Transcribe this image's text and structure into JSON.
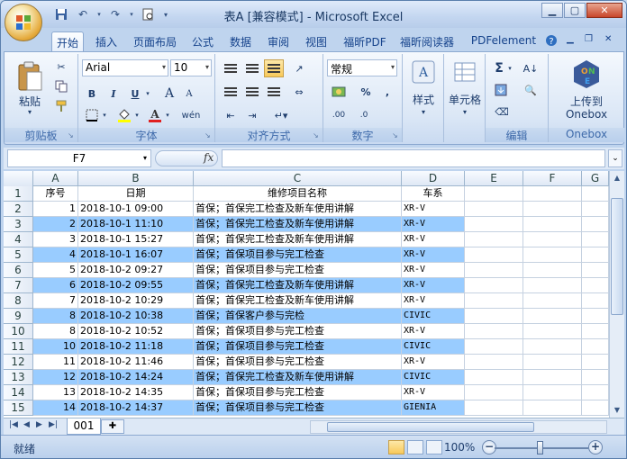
{
  "window": {
    "title": "表A  [兼容模式] - Microsoft Excel",
    "minimize_icon": "minimize-icon",
    "maximize_icon": "maximize-icon",
    "close_icon": "close-icon"
  },
  "ribbon_tabs": [
    {
      "label": "开始",
      "active": true
    },
    {
      "label": "插入"
    },
    {
      "label": "页面布局"
    },
    {
      "label": "公式"
    },
    {
      "label": "数据"
    },
    {
      "label": "审阅"
    },
    {
      "label": "视图"
    },
    {
      "label": "福昕PDF"
    },
    {
      "label": "福昕阅读器"
    },
    {
      "label": "PDFelement"
    }
  ],
  "ribbon": {
    "clipboard": {
      "label": "剪贴板",
      "paste": "粘贴"
    },
    "font": {
      "label": "字体",
      "font_name": "Arial",
      "font_size": "10",
      "bold": "B",
      "italic": "I",
      "underline": "U",
      "grow": "A",
      "shrink": "A",
      "phonetic": "wén"
    },
    "alignment": {
      "label": "对齐方式"
    },
    "number": {
      "label": "数字",
      "format": "常规",
      "percent": "%",
      "comma": ","
    },
    "styles": {
      "label": "样式"
    },
    "cells": {
      "label": "单元格"
    },
    "editing": {
      "label": "编辑",
      "sum": "Σ"
    },
    "onebox": {
      "label": "Onebox",
      "upload": "上传到",
      "upload2": "Onebox"
    }
  },
  "formula_bar": {
    "name_box": "F7",
    "fx": "fx",
    "formula": ""
  },
  "sheet": {
    "columns": [
      "A",
      "B",
      "C",
      "D",
      "E",
      "F",
      "G"
    ],
    "header_row": {
      "num": "1",
      "a": "序号",
      "b": "日期",
      "c": "维修项目名称",
      "d": "车系"
    },
    "rows": [
      {
        "num": "2",
        "a": "1",
        "b": "2018-10-1  09:00",
        "c": "首保；首保完工检查及新车使用讲解",
        "d": "XR-V",
        "blue": false
      },
      {
        "num": "3",
        "a": "2",
        "b": "2018-10-1  11:10",
        "c": "首保；首保完工检查及新车使用讲解",
        "d": "XR-V",
        "blue": true
      },
      {
        "num": "4",
        "a": "3",
        "b": "2018-10-1  15:27",
        "c": "首保；首保完工检查及新车使用讲解",
        "d": "XR-V",
        "blue": false
      },
      {
        "num": "5",
        "a": "4",
        "b": "2018-10-1  16:07",
        "c": "首保；首保项目参与完工检查",
        "d": "XR-V",
        "blue": true
      },
      {
        "num": "6",
        "a": "5",
        "b": "2018-10-2  09:27",
        "c": "首保；首保项目参与完工检查",
        "d": "XR-V",
        "blue": false
      },
      {
        "num": "7",
        "a": "6",
        "b": "2018-10-2  09:55",
        "c": "首保；首保完工检查及新车使用讲解",
        "d": "XR-V",
        "blue": true
      },
      {
        "num": "8",
        "a": "7",
        "b": "2018-10-2  10:29",
        "c": "首保；首保完工检查及新车使用讲解",
        "d": "XR-V",
        "blue": false
      },
      {
        "num": "9",
        "a": "8",
        "b": "2018-10-2  10:38",
        "c": "首保；首保客户参与完检",
        "d": "CIVIC",
        "blue": true
      },
      {
        "num": "10",
        "a": "8",
        "b": "2018-10-2  10:52",
        "c": "首保；首保项目参与完工检查",
        "d": "XR-V",
        "blue": false
      },
      {
        "num": "11",
        "a": "10",
        "b": "2018-10-2  11:18",
        "c": "首保；首保项目参与完工检查",
        "d": "CIVIC",
        "blue": true
      },
      {
        "num": "12",
        "a": "11",
        "b": "2018-10-2  11:46",
        "c": "首保；首保项目参与完工检查",
        "d": "XR-V",
        "blue": false
      },
      {
        "num": "13",
        "a": "12",
        "b": "2018-10-2  14:24",
        "c": "首保；首保完工检查及新车使用讲解",
        "d": "CIVIC",
        "blue": true
      },
      {
        "num": "14",
        "a": "13",
        "b": "2018-10-2  14:35",
        "c": "首保；首保项目参与完工检查",
        "d": "XR-V",
        "blue": false
      },
      {
        "num": "15",
        "a": "14",
        "b": "2018-10-2  14:37",
        "c": "首保；首保项目参与完工检查",
        "d": "GIENIA",
        "blue": true
      }
    ]
  },
  "sheet_tabs": [
    {
      "label": "001"
    }
  ],
  "status": {
    "ready": "就绪",
    "zoom": "100%"
  },
  "colors": {
    "row_highlight": "#99ccff",
    "ribbon_text": "#15428b"
  }
}
